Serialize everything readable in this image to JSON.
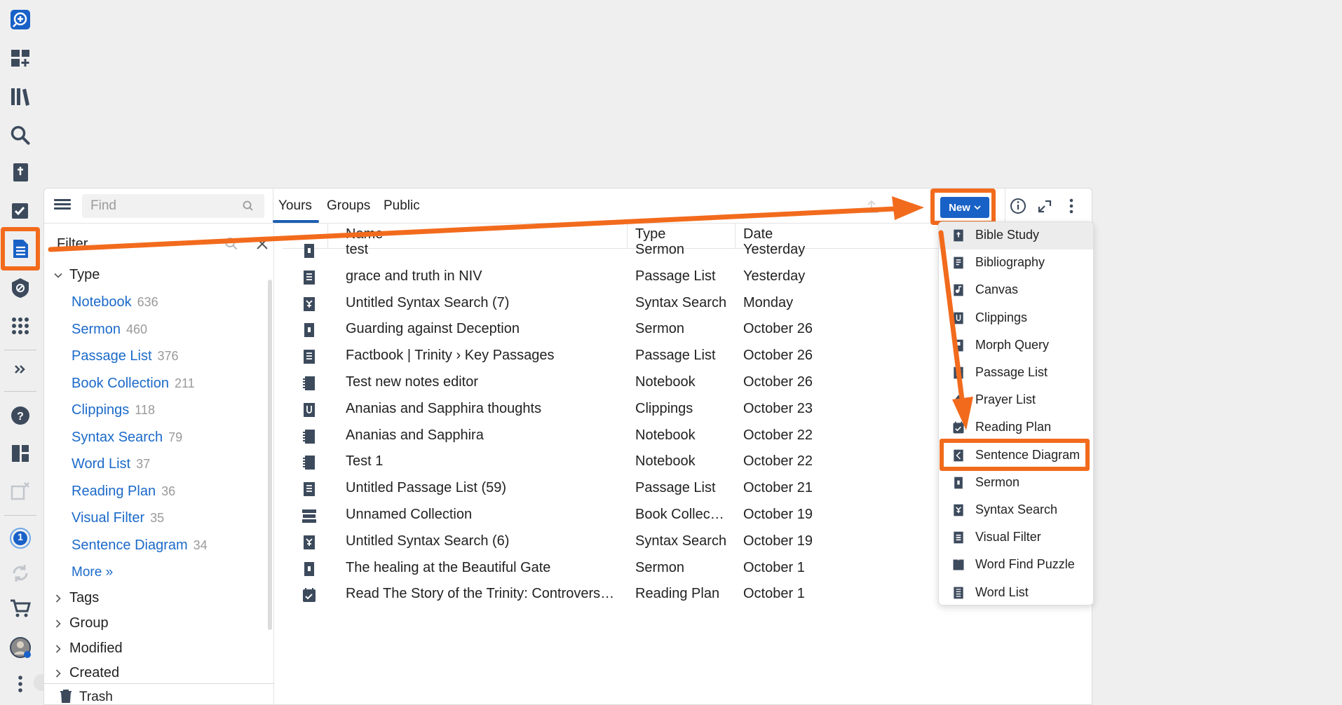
{
  "search": {
    "placeholder": "Find"
  },
  "tabs": [
    {
      "label": "Yours"
    },
    {
      "label": "Groups"
    },
    {
      "label": "Public"
    }
  ],
  "toolbar": {
    "new_label": "New"
  },
  "filter": {
    "title": "Filter",
    "type_section": "Type",
    "types": [
      {
        "label": "Notebook",
        "count": "636"
      },
      {
        "label": "Sermon",
        "count": "460"
      },
      {
        "label": "Passage List",
        "count": "376"
      },
      {
        "label": "Book Collection",
        "count": "211"
      },
      {
        "label": "Clippings",
        "count": "118"
      },
      {
        "label": "Syntax Search",
        "count": "79"
      },
      {
        "label": "Word List",
        "count": "37"
      },
      {
        "label": "Reading Plan",
        "count": "36"
      },
      {
        "label": "Visual Filter",
        "count": "35"
      },
      {
        "label": "Sentence Diagram",
        "count": "34"
      }
    ],
    "more_label": "More »",
    "sections": [
      "Tags",
      "Group",
      "Modified",
      "Created"
    ],
    "trash_label": "Trash"
  },
  "list": {
    "columns": {
      "name": "Name",
      "type": "Type",
      "date": "Date"
    },
    "rows": [
      {
        "icon": "sermon-icon",
        "name": "test",
        "type": "Sermon",
        "date": "Yesterday"
      },
      {
        "icon": "passage-list-icon",
        "name": "grace and truth in NIV",
        "type": "Passage List",
        "date": "Yesterday"
      },
      {
        "icon": "syntax-search-icon",
        "name": "Untitled Syntax Search (7)",
        "type": "Syntax Search",
        "date": "Monday"
      },
      {
        "icon": "sermon-icon",
        "name": "Guarding against Deception",
        "type": "Sermon",
        "date": "October 26"
      },
      {
        "icon": "passage-list-icon",
        "name": "Factbook | Trinity › Key Passages",
        "type": "Passage List",
        "date": "October 26"
      },
      {
        "icon": "notebook-icon",
        "name": "Test new notes editor",
        "type": "Notebook",
        "date": "October 26"
      },
      {
        "icon": "clippings-icon",
        "name": "Ananias and Sapphira thoughts",
        "type": "Clippings",
        "date": "October 23"
      },
      {
        "icon": "notebook-icon",
        "name": "Ananias and Sapphira",
        "type": "Notebook",
        "date": "October 22"
      },
      {
        "icon": "notebook-icon",
        "name": "Test 1",
        "type": "Notebook",
        "date": "October 22"
      },
      {
        "icon": "passage-list-icon",
        "name": "Untitled Passage List (59)",
        "type": "Passage List",
        "date": "October 21"
      },
      {
        "icon": "book-collection-icon",
        "name": "Unnamed Collection",
        "type": "Book Collec…",
        "date": "October 19"
      },
      {
        "icon": "syntax-search-icon",
        "name": "Untitled Syntax Search (6)",
        "type": "Syntax Search",
        "date": "October 19"
      },
      {
        "icon": "sermon-icon",
        "name": "The healing at the Beautiful Gate",
        "type": "Sermon",
        "date": "October 1"
      },
      {
        "icon": "reading-plan-icon",
        "name": "Read The Story of the Trinity: Controvers…",
        "type": "Reading Plan",
        "date": "October 1"
      }
    ]
  },
  "new_menu": {
    "items": [
      {
        "label": "Bible Study",
        "icon": "bible-study-icon"
      },
      {
        "label": "Bibliography",
        "icon": "bibliography-icon"
      },
      {
        "label": "Canvas",
        "icon": "canvas-icon"
      },
      {
        "label": "Clippings",
        "icon": "clippings-icon"
      },
      {
        "label": "Morph Query",
        "icon": "morph-query-icon"
      },
      {
        "label": "Passage List",
        "icon": "passage-list-icon"
      },
      {
        "label": "Prayer List",
        "icon": "prayer-list-icon"
      },
      {
        "label": "Reading Plan",
        "icon": "reading-plan-icon"
      },
      {
        "label": "Sentence Diagram",
        "icon": "sentence-diagram-icon"
      },
      {
        "label": "Sermon",
        "icon": "sermon-icon"
      },
      {
        "label": "Syntax Search",
        "icon": "syntax-search-icon"
      },
      {
        "label": "Visual Filter",
        "icon": "visual-filter-icon"
      },
      {
        "label": "Word Find Puzzle",
        "icon": "word-find-puzzle-icon"
      },
      {
        "label": "Word List",
        "icon": "word-list-icon"
      }
    ]
  },
  "rail": {
    "notification_count": "1"
  },
  "colors": {
    "accent": "#1861c7",
    "link": "#1b6ac9",
    "annotation": "#f26b1d",
    "icon": "#3c4a5c"
  }
}
